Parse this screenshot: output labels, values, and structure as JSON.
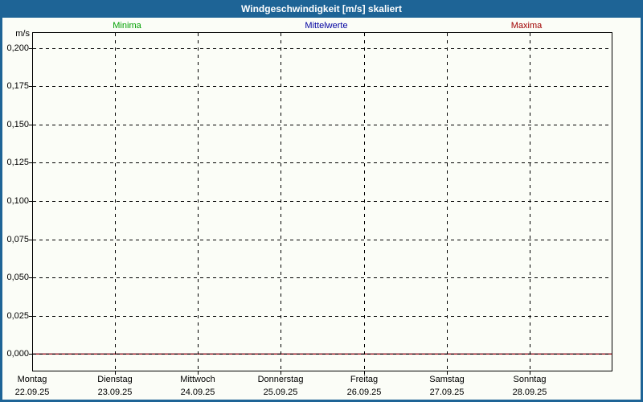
{
  "window": {
    "title": "Windgeschwindigkeit [m/s] skaliert",
    "colors": {
      "titlebar_bg": "#1e6496",
      "border": "#1e6496",
      "content_bg": "#fbfdf7",
      "grid": "#000000",
      "axis": "#000000"
    }
  },
  "legend": {
    "items": [
      {
        "label": "Minima",
        "color": "#00a000"
      },
      {
        "label": "Mittelwerte",
        "color": "#0000a0"
      },
      {
        "label": "Maxima",
        "color": "#a00000"
      }
    ]
  },
  "chart_data": {
    "type": "line",
    "title": "Windgeschwindigkeit [m/s] skaliert",
    "ylabel": "m/s",
    "xlabel": "",
    "ylim": [
      0,
      0.2
    ],
    "grid": true,
    "legend_position": "top",
    "y_tick_labels": [
      "0,200",
      "0,175",
      "0,150",
      "0,125",
      "0,100",
      "0,075",
      "0,050",
      "0,025",
      "0,000"
    ],
    "y_tick_values": [
      0.2,
      0.175,
      0.15,
      0.125,
      0.1,
      0.075,
      0.05,
      0.025,
      0.0
    ],
    "x_categories": [
      {
        "day": "Montag",
        "date": "22.09.25"
      },
      {
        "day": "Dienstag",
        "date": "23.09.25"
      },
      {
        "day": "Mittwoch",
        "date": "24.09.25"
      },
      {
        "day": "Donnerstag",
        "date": "25.09.25"
      },
      {
        "day": "Freitag",
        "date": "26.09.25"
      },
      {
        "day": "Samstag",
        "date": "27.09.25"
      },
      {
        "day": "Sonntag",
        "date": "28.09.25"
      }
    ],
    "series": [
      {
        "name": "Minima",
        "color": "#00a000",
        "values": [
          0,
          0,
          0,
          0,
          0,
          0,
          0
        ]
      },
      {
        "name": "Mittelwerte",
        "color": "#0000a0",
        "values": [
          0,
          0,
          0,
          0,
          0,
          0,
          0
        ]
      },
      {
        "name": "Maxima",
        "color": "#cc0000",
        "values": [
          0,
          0,
          0,
          0,
          0,
          0,
          0
        ]
      }
    ]
  }
}
